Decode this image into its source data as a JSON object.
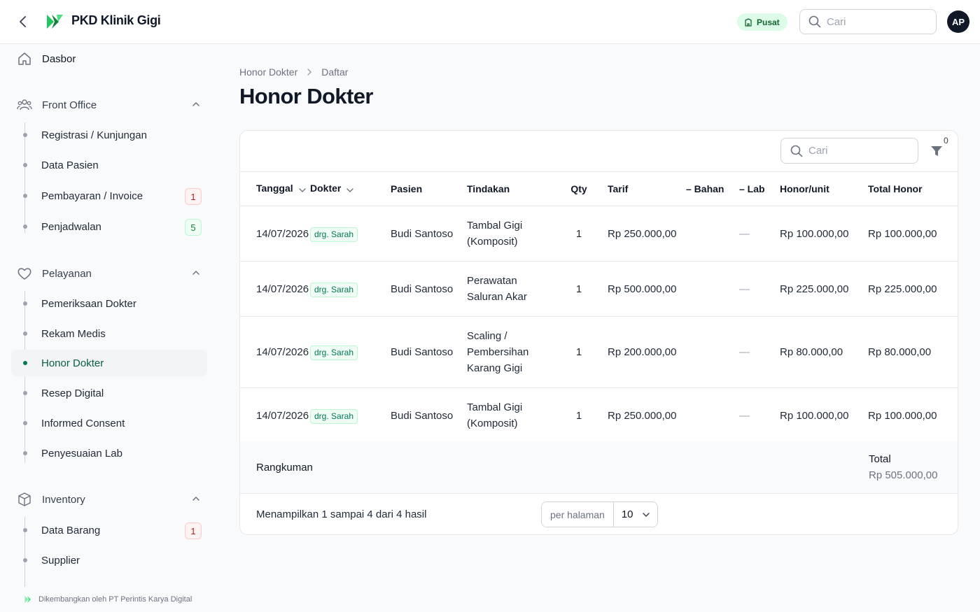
{
  "header": {
    "app_title": "PKD Klinik Gigi",
    "branch": "Pusat",
    "search_placeholder": "Cari",
    "avatar_initials": "AP"
  },
  "sidebar": {
    "dashboard": "Dasbor",
    "groups": [
      {
        "label": "Front Office",
        "items": [
          {
            "label": "Registrasi / Kunjungan"
          },
          {
            "label": "Data Pasien"
          },
          {
            "label": "Pembayaran / Invoice",
            "badge": "1"
          },
          {
            "label": "Penjadwalan",
            "badge": "5"
          }
        ]
      },
      {
        "label": "Pelayanan",
        "items": [
          {
            "label": "Pemeriksaan Dokter"
          },
          {
            "label": "Rekam Medis"
          },
          {
            "label": "Honor Dokter",
            "active": true
          },
          {
            "label": "Resep Digital"
          },
          {
            "label": "Informed Consent"
          },
          {
            "label": "Penyesuaian Lab"
          }
        ]
      },
      {
        "label": "Inventory",
        "items": [
          {
            "label": "Data Barang",
            "badge": "1"
          },
          {
            "label": "Supplier"
          }
        ]
      }
    ],
    "footer": "Dikembangkan oleh PT Perintis Karya Digital"
  },
  "breadcrumb": [
    "Honor Dokter",
    "Daftar"
  ],
  "page_title": "Honor Dokter",
  "table": {
    "search_placeholder": "Cari",
    "filter_count": "0",
    "columns": [
      "Tanggal",
      "Dokter",
      "Pasien",
      "Tindakan",
      "Qty",
      "Tarif",
      "– Bahan",
      "– Lab",
      "Honor/unit",
      "Total Honor"
    ],
    "rows": [
      {
        "tanggal": "14/07/2026",
        "dokter": "drg. Sarah",
        "pasien": "Budi Santoso",
        "tindakan": [
          "Tambal Gigi",
          "(Komposit)"
        ],
        "qty": "1",
        "tarif": "Rp 250.000,00",
        "bahan": "",
        "lab": "—",
        "honor_unit": "Rp 100.000,00",
        "total": "Rp 100.000,00"
      },
      {
        "tanggal": "14/07/2026",
        "dokter": "drg. Sarah",
        "pasien": "Budi Santoso",
        "tindakan": [
          "Perawatan",
          "Saluran Akar"
        ],
        "qty": "1",
        "tarif": "Rp 500.000,00",
        "bahan": "",
        "lab": "—",
        "honor_unit": "Rp 225.000,00",
        "total": "Rp 225.000,00"
      },
      {
        "tanggal": "14/07/2026",
        "dokter": "drg. Sarah",
        "pasien": "Budi Santoso",
        "tindakan": [
          "Scaling /",
          "Pembersihan",
          "Karang Gigi"
        ],
        "qty": "1",
        "tarif": "Rp 200.000,00",
        "bahan": "",
        "lab": "—",
        "honor_unit": "Rp 80.000,00",
        "total": "Rp 80.000,00"
      },
      {
        "tanggal": "14/07/2026",
        "dokter": "drg. Sarah",
        "pasien": "Budi Santoso",
        "tindakan": [
          "Tambal Gigi",
          "(Komposit)"
        ],
        "qty": "1",
        "tarif": "Rp 250.000,00",
        "bahan": "",
        "lab": "—",
        "honor_unit": "Rp 100.000,00",
        "total": "Rp 100.000,00"
      }
    ],
    "summary_label": "Rangkuman",
    "total_label": "Total",
    "total_value": "Rp 505.000,00",
    "pagination_text": "Menampilkan 1 sampai 4 dari 4 hasil",
    "per_page_label": "per halaman",
    "per_page_value": "10"
  },
  "colors": {
    "accent": "#047857",
    "badge_red": "#b91c1c",
    "badge_green": "#15803d"
  }
}
